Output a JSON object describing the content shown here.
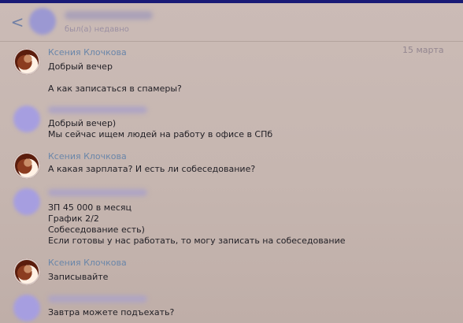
{
  "header": {
    "back_icon": "<",
    "status": "был(а) недавно"
  },
  "date": "15 марта",
  "messages": [
    {
      "sender": "Ксения Клочкова",
      "lines": [
        "Добрый вечер",
        "",
        "А как записаться в спамеры?"
      ]
    },
    {
      "sender": "",
      "lines": [
        "Добрый вечер)",
        "Мы сейчас ищем людей на работу в офисе в СПб"
      ]
    },
    {
      "sender": "Ксения Клочкова",
      "lines": [
        "А какая зарплата? И есть ли собеседование?"
      ]
    },
    {
      "sender": "",
      "lines": [
        "ЗП 45 000 в месяц",
        "График 2/2",
        "Собеседование есть)",
        "Если готовы у нас работать, то могу записать на собеседование"
      ]
    },
    {
      "sender": "Ксения Клочкова",
      "lines": [
        "Записывайте"
      ]
    },
    {
      "sender": "",
      "lines": [
        "Завтра можете подъехать?"
      ]
    }
  ],
  "icons": {
    "back": "chevron-left-icon",
    "avatar_named": "user-avatar-icon",
    "avatar_blurred": "blurred-avatar-icon"
  },
  "colors": {
    "background": "#c8b8b2",
    "top_stripe": "#191a76",
    "sender_name": "#6a86a9",
    "text": "#232127",
    "date": "#948790"
  }
}
